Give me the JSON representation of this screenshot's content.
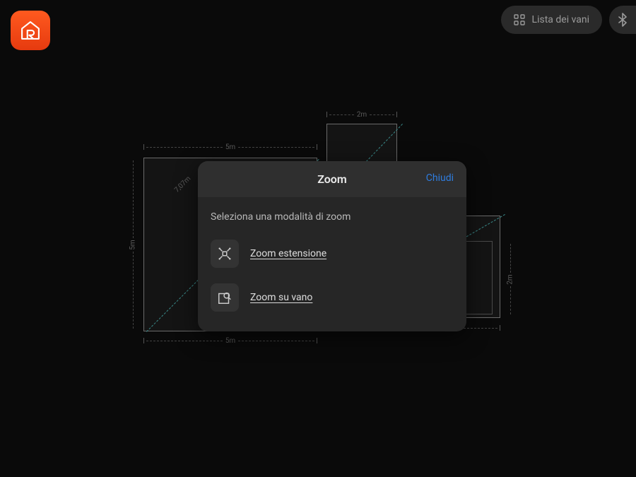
{
  "header": {
    "room_list_label": "Lista dei vani"
  },
  "floorplan": {
    "dims": {
      "top_a": "5m",
      "top_b": "2m",
      "bottom_a": "5m",
      "bottom_c": "5m",
      "left_a": "5m",
      "right_c": "2m",
      "diag_a": "7,07m"
    }
  },
  "modal": {
    "title": "Zoom",
    "close": "Chiudi",
    "subtitle": "Seleziona una modalità di zoom",
    "options": {
      "extent": "Zoom estensione",
      "room": "Zoom su vano"
    }
  }
}
